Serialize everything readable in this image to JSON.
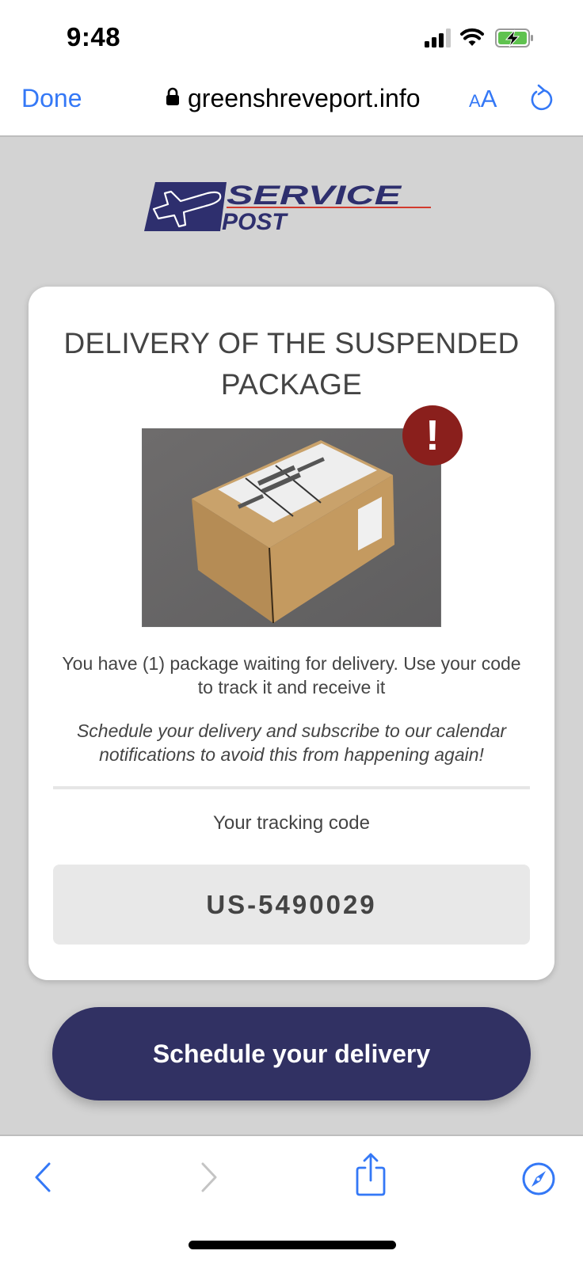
{
  "status_bar": {
    "time": "9:48",
    "icons": [
      "cellular-signal-icon",
      "wifi-icon",
      "battery-charging-icon"
    ]
  },
  "browser": {
    "done_label": "Done",
    "url": "greenshreveport.info",
    "secure_icon": "lock-icon",
    "text_size_small": "A",
    "text_size_large": "A",
    "reload_icon": "reload-icon"
  },
  "logo": {
    "line1": "SERVICE",
    "line2": "POST"
  },
  "card": {
    "title": "DELIVERY OF THE SUSPENDED PACKAGE",
    "alert_symbol": "!",
    "message": "You have (1) package waiting for delivery. Use your code to track it and receive it",
    "note": "Schedule your delivery and subscribe to our calendar notifications to avoid this from happening again!",
    "tracking_label": "Your tracking code",
    "tracking_code": "US-5490029"
  },
  "cta": {
    "label": "Schedule your delivery"
  },
  "toolbar": {
    "items": [
      "back-icon",
      "forward-icon",
      "share-icon",
      "compass-icon"
    ]
  },
  "colors": {
    "ios_blue": "#3478f6",
    "brand_navy": "#313163",
    "logo_navy": "#2e2f6e",
    "logo_red": "#d23a2e",
    "alert_red": "#8a1f1c",
    "page_bg": "#d3d3d3",
    "battery_green": "#5fc24f"
  }
}
